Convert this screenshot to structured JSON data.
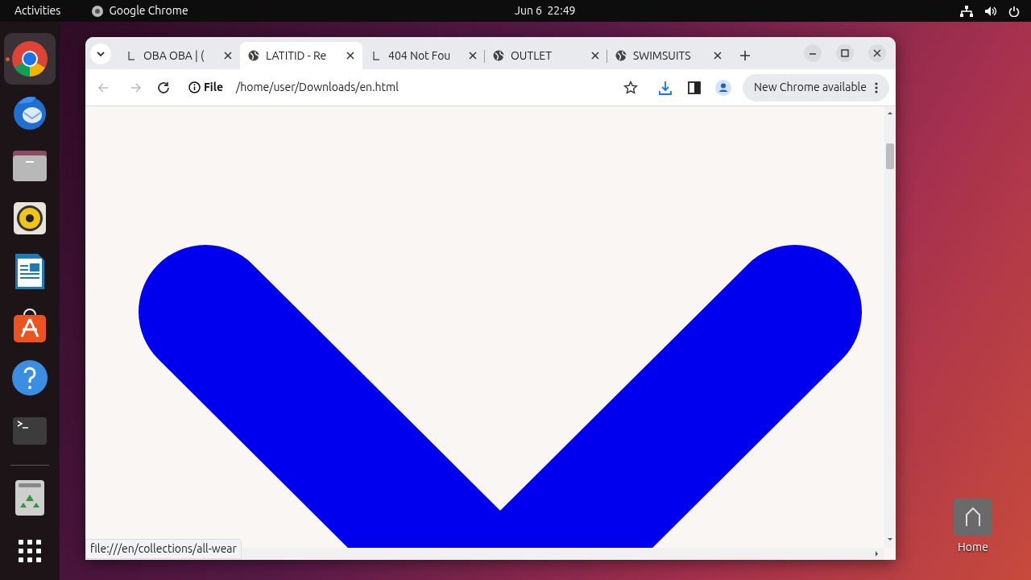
{
  "top_bar": {
    "activities": "Activities",
    "app_name": "Google Chrome",
    "clock": "Jun 6  22:49"
  },
  "dock": [
    {
      "kind": "chrome",
      "selected": true,
      "running": true
    },
    {
      "kind": "mail",
      "selected": false,
      "running": false
    },
    {
      "kind": "files",
      "selected": false,
      "running": false
    },
    {
      "kind": "speaker",
      "selected": false,
      "running": false
    },
    {
      "kind": "writer",
      "selected": false,
      "running": false
    },
    {
      "kind": "store",
      "selected": false,
      "running": false
    },
    {
      "kind": "help",
      "selected": false,
      "running": false
    },
    {
      "kind": "terminal",
      "selected": false,
      "running": false
    },
    {
      "kind": "trash",
      "selected": false,
      "running": false
    },
    {
      "kind": "apps",
      "selected": false,
      "running": false
    }
  ],
  "tabs": [
    {
      "title": "OBA OBA | (",
      "kind": "page",
      "selected": false
    },
    {
      "title": "LATITID - Re",
      "kind": "globe",
      "selected": true
    },
    {
      "title": "404 Not Fou",
      "kind": "page",
      "selected": false
    },
    {
      "title": "OUTLET",
      "kind": "globe",
      "selected": false
    },
    {
      "title": "SWIMSUITS",
      "kind": "globe",
      "selected": false
    }
  ],
  "address_bar": {
    "scheme": "File",
    "url": "/home/user/Downloads/en.html"
  },
  "update_button": "New Chrome available",
  "status_url": "file:///en/collections/all-wear",
  "desktop_icons": [
    {
      "label": "Home"
    }
  ]
}
